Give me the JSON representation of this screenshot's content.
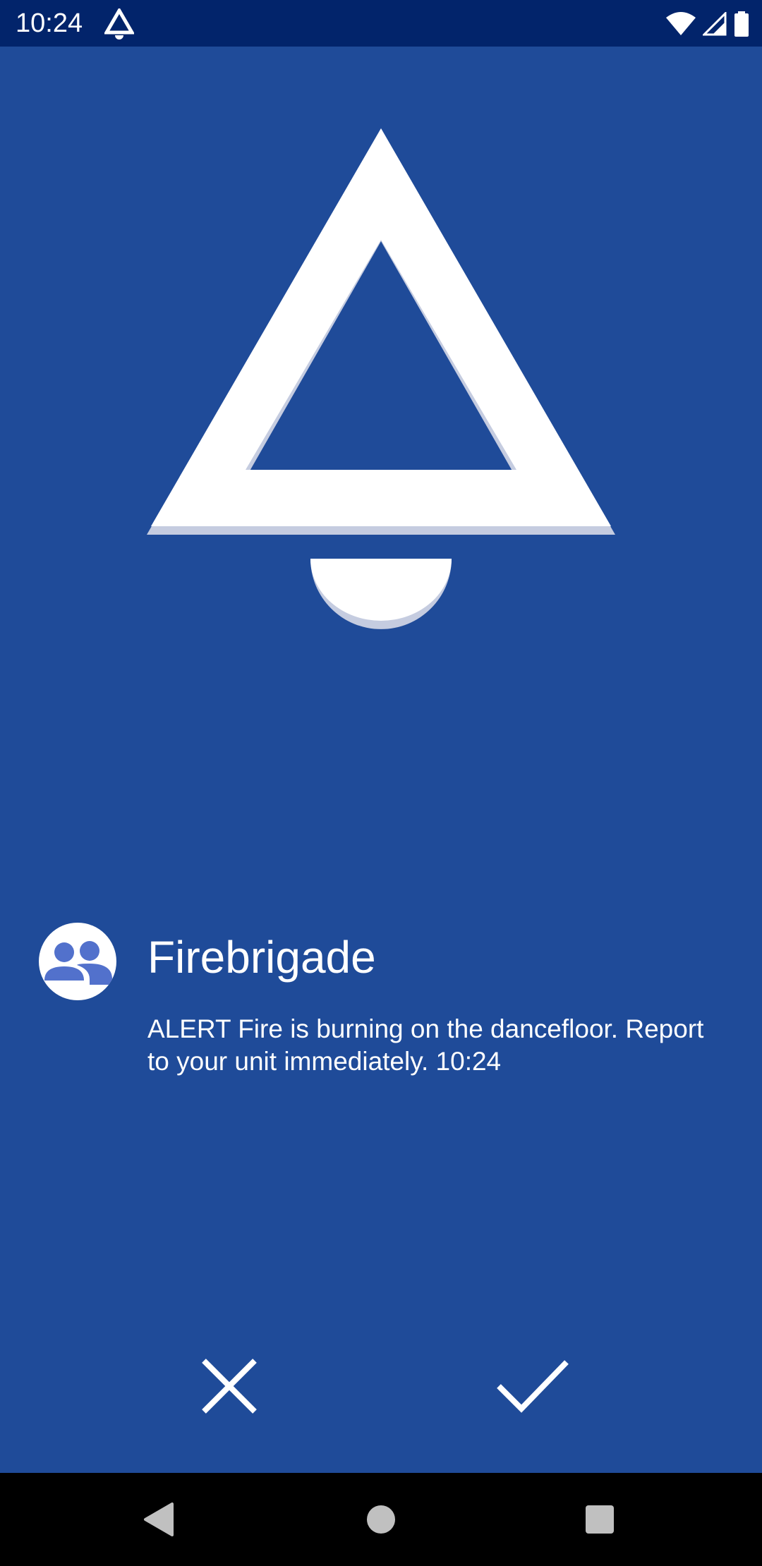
{
  "status_bar": {
    "time": "10:24",
    "icons": [
      "alert-triangle-icon",
      "wifi-icon",
      "cell-signal-icon",
      "battery-icon"
    ]
  },
  "hero": {
    "icon": "bell-icon"
  },
  "message": {
    "avatar_icon": "group-icon",
    "sender": "Firebrigade",
    "body": "ALERT Fire is burning on the dancefloor. Report to your unit immediately. 10:24"
  },
  "actions": {
    "dismiss_icon": "close-icon",
    "accept_icon": "check-icon"
  },
  "nav_bar": {
    "icons": [
      "back-icon",
      "home-icon",
      "recents-icon"
    ]
  },
  "colors": {
    "background": "#1f4b99",
    "status_bar": "#02246b",
    "foreground": "#ffffff",
    "shadow": "#c5cce0",
    "avatar_figure": "#5271cc",
    "nav_bar": "#000000",
    "nav_icons": "#c0c0c0"
  }
}
